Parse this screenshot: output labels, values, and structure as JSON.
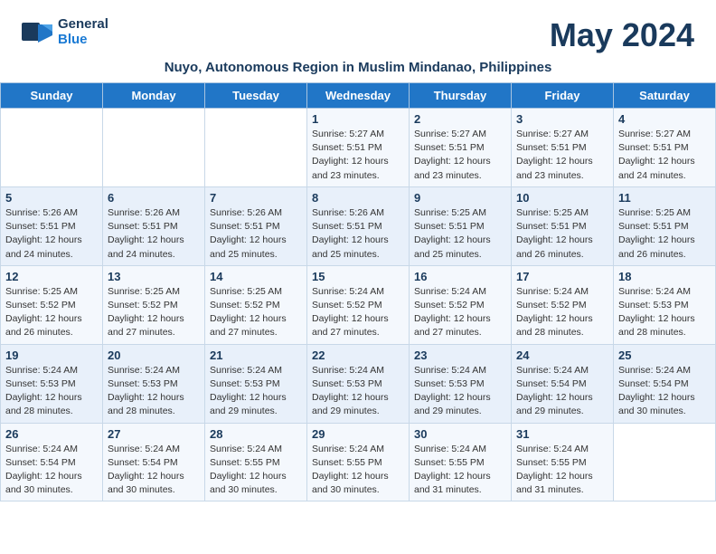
{
  "header": {
    "logo_line1": "General",
    "logo_line2": "Blue",
    "month_year": "May 2024",
    "subtitle": "Nuyo, Autonomous Region in Muslim Mindanao, Philippines"
  },
  "weekdays": [
    "Sunday",
    "Monday",
    "Tuesday",
    "Wednesday",
    "Thursday",
    "Friday",
    "Saturday"
  ],
  "weeks": [
    [
      {
        "day": "",
        "info": ""
      },
      {
        "day": "",
        "info": ""
      },
      {
        "day": "",
        "info": ""
      },
      {
        "day": "1",
        "info": "Sunrise: 5:27 AM\nSunset: 5:51 PM\nDaylight: 12 hours\nand 23 minutes."
      },
      {
        "day": "2",
        "info": "Sunrise: 5:27 AM\nSunset: 5:51 PM\nDaylight: 12 hours\nand 23 minutes."
      },
      {
        "day": "3",
        "info": "Sunrise: 5:27 AM\nSunset: 5:51 PM\nDaylight: 12 hours\nand 23 minutes."
      },
      {
        "day": "4",
        "info": "Sunrise: 5:27 AM\nSunset: 5:51 PM\nDaylight: 12 hours\nand 24 minutes."
      }
    ],
    [
      {
        "day": "5",
        "info": "Sunrise: 5:26 AM\nSunset: 5:51 PM\nDaylight: 12 hours\nand 24 minutes."
      },
      {
        "day": "6",
        "info": "Sunrise: 5:26 AM\nSunset: 5:51 PM\nDaylight: 12 hours\nand 24 minutes."
      },
      {
        "day": "7",
        "info": "Sunrise: 5:26 AM\nSunset: 5:51 PM\nDaylight: 12 hours\nand 25 minutes."
      },
      {
        "day": "8",
        "info": "Sunrise: 5:26 AM\nSunset: 5:51 PM\nDaylight: 12 hours\nand 25 minutes."
      },
      {
        "day": "9",
        "info": "Sunrise: 5:25 AM\nSunset: 5:51 PM\nDaylight: 12 hours\nand 25 minutes."
      },
      {
        "day": "10",
        "info": "Sunrise: 5:25 AM\nSunset: 5:51 PM\nDaylight: 12 hours\nand 26 minutes."
      },
      {
        "day": "11",
        "info": "Sunrise: 5:25 AM\nSunset: 5:51 PM\nDaylight: 12 hours\nand 26 minutes."
      }
    ],
    [
      {
        "day": "12",
        "info": "Sunrise: 5:25 AM\nSunset: 5:52 PM\nDaylight: 12 hours\nand 26 minutes."
      },
      {
        "day": "13",
        "info": "Sunrise: 5:25 AM\nSunset: 5:52 PM\nDaylight: 12 hours\nand 27 minutes."
      },
      {
        "day": "14",
        "info": "Sunrise: 5:25 AM\nSunset: 5:52 PM\nDaylight: 12 hours\nand 27 minutes."
      },
      {
        "day": "15",
        "info": "Sunrise: 5:24 AM\nSunset: 5:52 PM\nDaylight: 12 hours\nand 27 minutes."
      },
      {
        "day": "16",
        "info": "Sunrise: 5:24 AM\nSunset: 5:52 PM\nDaylight: 12 hours\nand 27 minutes."
      },
      {
        "day": "17",
        "info": "Sunrise: 5:24 AM\nSunset: 5:52 PM\nDaylight: 12 hours\nand 28 minutes."
      },
      {
        "day": "18",
        "info": "Sunrise: 5:24 AM\nSunset: 5:53 PM\nDaylight: 12 hours\nand 28 minutes."
      }
    ],
    [
      {
        "day": "19",
        "info": "Sunrise: 5:24 AM\nSunset: 5:53 PM\nDaylight: 12 hours\nand 28 minutes."
      },
      {
        "day": "20",
        "info": "Sunrise: 5:24 AM\nSunset: 5:53 PM\nDaylight: 12 hours\nand 28 minutes."
      },
      {
        "day": "21",
        "info": "Sunrise: 5:24 AM\nSunset: 5:53 PM\nDaylight: 12 hours\nand 29 minutes."
      },
      {
        "day": "22",
        "info": "Sunrise: 5:24 AM\nSunset: 5:53 PM\nDaylight: 12 hours\nand 29 minutes."
      },
      {
        "day": "23",
        "info": "Sunrise: 5:24 AM\nSunset: 5:53 PM\nDaylight: 12 hours\nand 29 minutes."
      },
      {
        "day": "24",
        "info": "Sunrise: 5:24 AM\nSunset: 5:54 PM\nDaylight: 12 hours\nand 29 minutes."
      },
      {
        "day": "25",
        "info": "Sunrise: 5:24 AM\nSunset: 5:54 PM\nDaylight: 12 hours\nand 30 minutes."
      }
    ],
    [
      {
        "day": "26",
        "info": "Sunrise: 5:24 AM\nSunset: 5:54 PM\nDaylight: 12 hours\nand 30 minutes."
      },
      {
        "day": "27",
        "info": "Sunrise: 5:24 AM\nSunset: 5:54 PM\nDaylight: 12 hours\nand 30 minutes."
      },
      {
        "day": "28",
        "info": "Sunrise: 5:24 AM\nSunset: 5:55 PM\nDaylight: 12 hours\nand 30 minutes."
      },
      {
        "day": "29",
        "info": "Sunrise: 5:24 AM\nSunset: 5:55 PM\nDaylight: 12 hours\nand 30 minutes."
      },
      {
        "day": "30",
        "info": "Sunrise: 5:24 AM\nSunset: 5:55 PM\nDaylight: 12 hours\nand 31 minutes."
      },
      {
        "day": "31",
        "info": "Sunrise: 5:24 AM\nSunset: 5:55 PM\nDaylight: 12 hours\nand 31 minutes."
      },
      {
        "day": "",
        "info": ""
      }
    ]
  ]
}
